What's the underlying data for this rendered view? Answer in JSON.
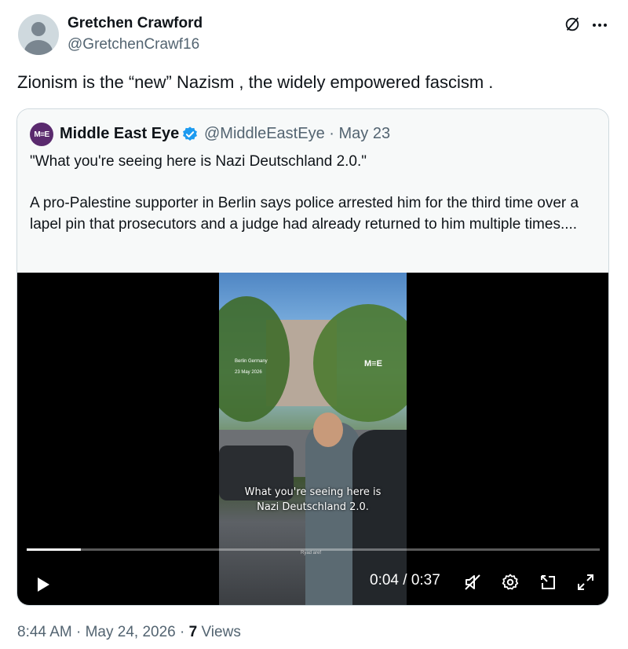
{
  "author": {
    "name": "Gretchen Crawford",
    "handle": "@GretchenCrawf16"
  },
  "tweet": {
    "text": "Zionism is the “new” Nazism , the widely empowered fascism ."
  },
  "icons": {
    "grok": "grok-slash-icon",
    "more": "more-horizontal-icon",
    "verified": "verified-badge-icon"
  },
  "quote": {
    "logo_text": "M≡E",
    "name": "Middle East Eye",
    "handle_date": "@MiddleEastEye · May 23",
    "text": "\"What you're seeing here is Nazi Deutschland 2.0.\"\n\nA pro-Palestine supporter in Berlin says police arrested him for the third time over a lapel pin that prosecutors and a judge had already returned to him multiple times...."
  },
  "video": {
    "location_line1": "Berlin Germany",
    "location_line2": "23 May 2026",
    "watermark": "M≡E",
    "subtitle_line1": "What you're seeing here is",
    "subtitle_line2": "Nazi Deutschland 2.0.",
    "credit": "Ryad aref",
    "progress_fraction": 0.095,
    "time": "0:04 / 0:37"
  },
  "meta": {
    "timestamp": "8:44 AM · May 24, 2026 · ",
    "views_count": "7",
    "views_label": " Views"
  },
  "colors": {
    "text_primary": "#0f1419",
    "text_secondary": "#536471",
    "verified": "#1d9bf0",
    "mee_brand": "#5a2a6e"
  }
}
